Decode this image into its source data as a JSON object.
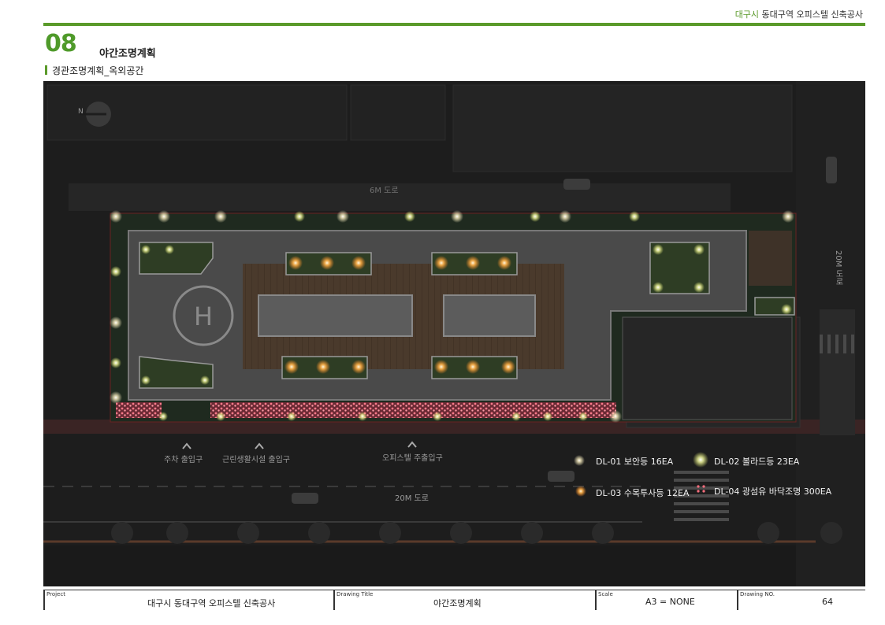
{
  "header": {
    "project_accent": "대구시",
    "project_rest": " 동대구역 오피스텔 신축공사",
    "section_number": "08",
    "section_title": "야간조명계획",
    "subtitle": "경관조명계획_옥외공간"
  },
  "plan": {
    "north_label": "N",
    "helipad_letter": "H",
    "road_top": "6M 도로",
    "road_right": "20M 도로",
    "road_bottom": "20M 도로",
    "entrances": [
      {
        "label": "주차 출입구"
      },
      {
        "label": "근린생활시설 출입구"
      },
      {
        "label": "오피스텔 주출입구"
      }
    ]
  },
  "legend": [
    {
      "label": "DL-01 보안등 16EA",
      "color": "#fff3c4"
    },
    {
      "label": "DL-02 볼라드등 23EA",
      "color": "#ecf29a"
    },
    {
      "label": "DL-03 수목투사등 12EA",
      "color": "#ffb048"
    },
    {
      "label": "DL-04 광섬유 바닥조명 300EA",
      "color": "#ff6f7e"
    }
  ],
  "footer": {
    "project_key": "Project",
    "project_value": "대구시 동대구역 오피스텔 신축공사",
    "drawing_title_key": "Drawing Title",
    "drawing_title_value": "야간조명계획",
    "scale_key": "Scale",
    "scale_value": "A3 = NONE",
    "drawing_no_key": "Drawing NO.",
    "drawing_no_value": "64"
  },
  "colors": {
    "accent_green": "#5a9a2a",
    "night_background": "#1d1d1d",
    "deck_wood": "#4a3a2c"
  }
}
